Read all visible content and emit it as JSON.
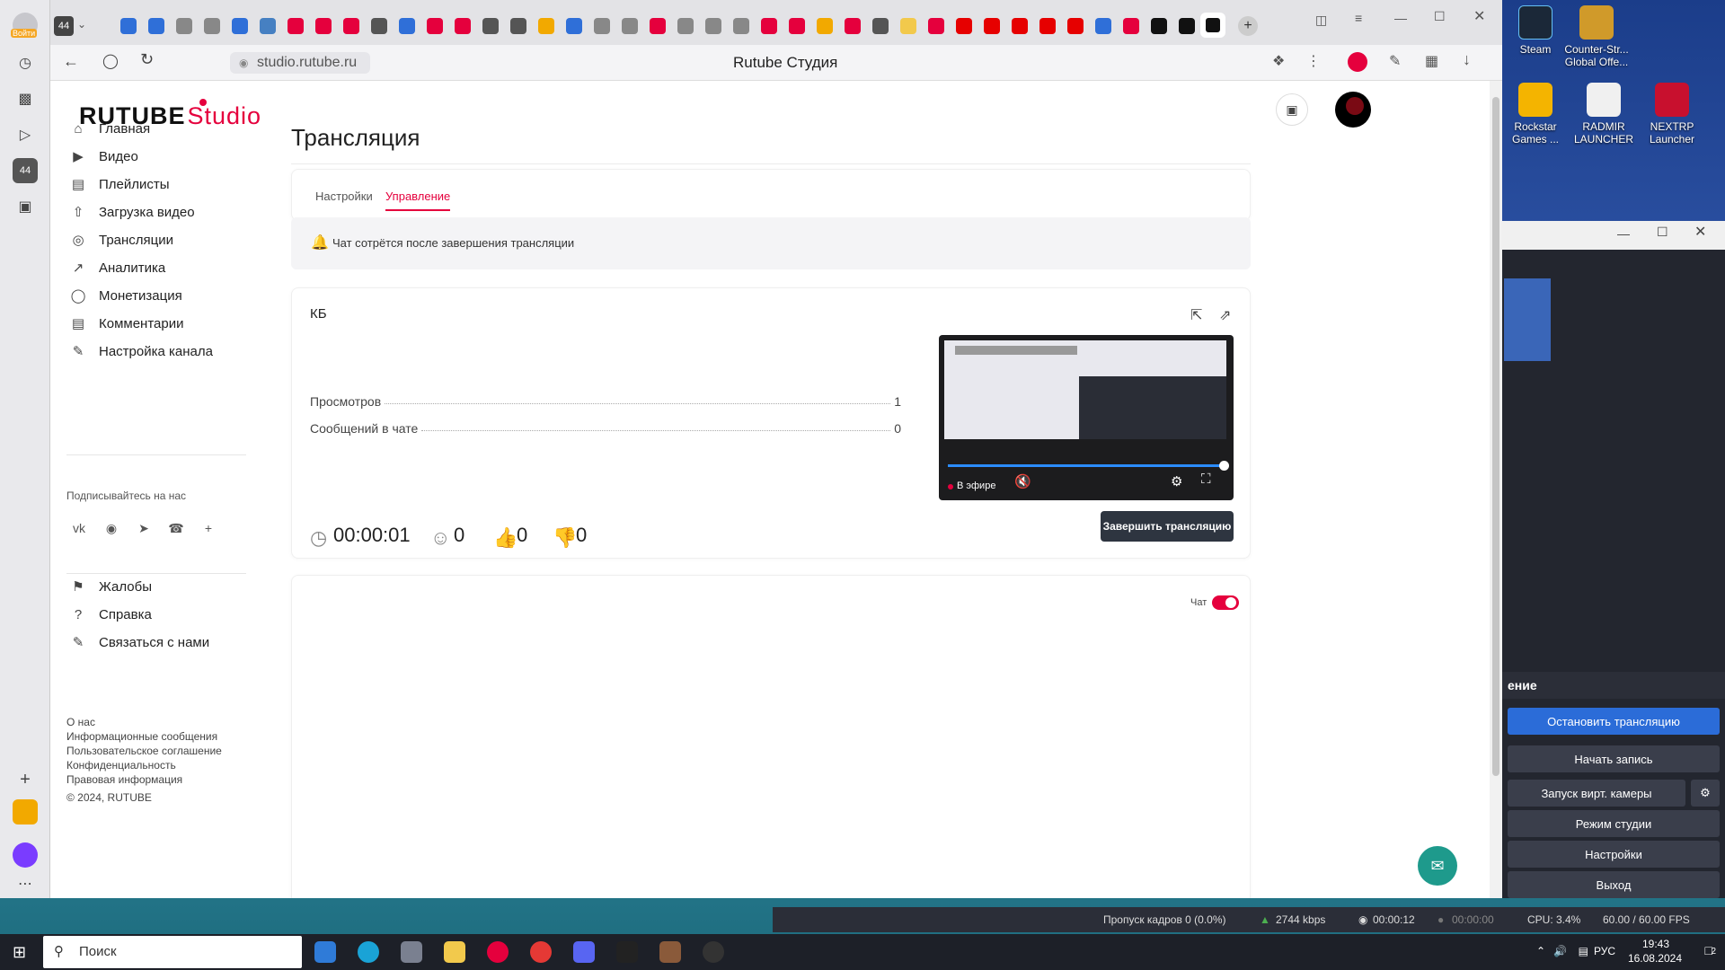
{
  "desktop": {
    "icons": [
      {
        "label": "Steam"
      },
      {
        "label": "Counter-Str... Global Offe..."
      },
      {
        "label": "Rockstar Games ..."
      },
      {
        "label": "RADMIR LAUNCHER"
      },
      {
        "label": "NEXTRP Launcher"
      }
    ]
  },
  "browser": {
    "side_panel": {
      "login_label": "Войти",
      "badge": "44"
    },
    "tab_badge": "44",
    "url": "studio.rutube.ru",
    "page_title": "Rutube Студия"
  },
  "studio": {
    "logo": {
      "main": "RUTUBE",
      "suffix": "Studio"
    },
    "nav": [
      {
        "label": "Главная",
        "icon": "home-icon"
      },
      {
        "label": "Видео",
        "icon": "video-icon"
      },
      {
        "label": "Плейлисты",
        "icon": "playlist-icon"
      },
      {
        "label": "Загрузка видео",
        "icon": "upload-icon"
      },
      {
        "label": "Трансляции",
        "icon": "broadcast-icon"
      },
      {
        "label": "Аналитика",
        "icon": "analytics-icon"
      },
      {
        "label": "Монетизация",
        "icon": "monetization-icon"
      },
      {
        "label": "Комментарии",
        "icon": "comments-icon"
      },
      {
        "label": "Настройка канала",
        "icon": "channel-settings-icon"
      }
    ],
    "subscribe_label": "Подписывайтесь на нас",
    "nav_secondary": [
      {
        "label": "Жалобы",
        "icon": "flag-icon"
      },
      {
        "label": "Справка",
        "icon": "help-icon"
      },
      {
        "label": "Связаться с нами",
        "icon": "contact-icon"
      }
    ],
    "footer_links": [
      "О нас",
      "Информационные сообщения",
      "Пользовательское соглашение",
      "Конфиденциальность",
      "Правовая информация"
    ],
    "copyright": "© 2024, RUTUBE",
    "page_heading": "Трансляция",
    "tabs": [
      {
        "label": "Настройки",
        "active": false
      },
      {
        "label": "Управление",
        "active": true
      }
    ],
    "notice": "Чат сотрётся после завершения трансляции",
    "stream": {
      "title": "КБ",
      "views_label": "Просмотров",
      "views_value": "1",
      "messages_label": "Сообщений в чате",
      "messages_value": "0",
      "duration": "00:00:01",
      "viewers": "0",
      "likes": "0",
      "dislikes": "0",
      "preview_live_label": "В эфире",
      "end_button": "Завершить трансляцию"
    },
    "chat_label": "Чат",
    "accent_color": "#e5003d"
  },
  "obs": {
    "section_title": "ение",
    "buttons": [
      "Остановить трансляцию",
      "Начать запись",
      "Запуск вирт. камеры",
      "Режим студии",
      "Настройки",
      "Выход"
    ],
    "status": {
      "dropped_frames": "Пропуск кадров 0 (0.0%)",
      "bitrate": "2744 kbps",
      "stream_time": "00:00:12",
      "rec_time": "00:00:00",
      "cpu": "CPU: 3.4%",
      "fps": "60.00 / 60.00 FPS"
    }
  },
  "taskbar": {
    "search_placeholder": "Поиск",
    "lang": "РУС",
    "time": "19:43",
    "date": "16.08.2024",
    "notifications": "2"
  }
}
